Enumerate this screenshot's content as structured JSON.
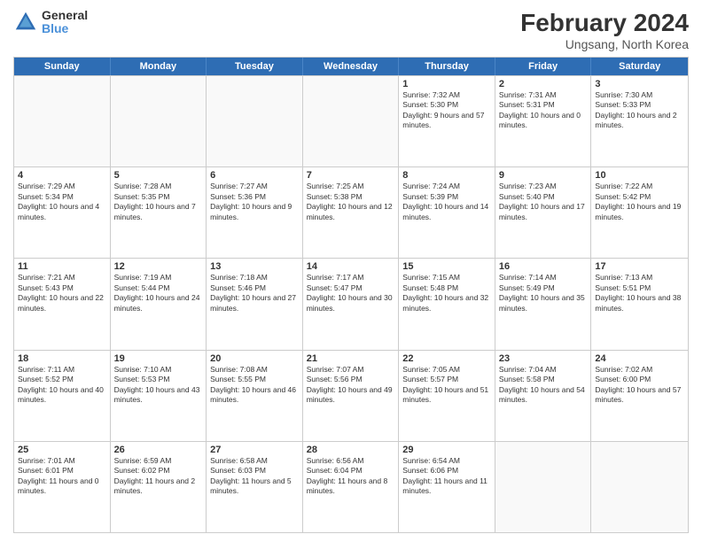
{
  "logo": {
    "general": "General",
    "blue": "Blue"
  },
  "title": {
    "month": "February 2024",
    "location": "Ungsang, North Korea"
  },
  "header_days": [
    "Sunday",
    "Monday",
    "Tuesday",
    "Wednesday",
    "Thursday",
    "Friday",
    "Saturday"
  ],
  "weeks": [
    [
      {
        "day": "",
        "content": ""
      },
      {
        "day": "",
        "content": ""
      },
      {
        "day": "",
        "content": ""
      },
      {
        "day": "",
        "content": ""
      },
      {
        "day": "1",
        "content": "Sunrise: 7:32 AM\nSunset: 5:30 PM\nDaylight: 9 hours and 57 minutes."
      },
      {
        "day": "2",
        "content": "Sunrise: 7:31 AM\nSunset: 5:31 PM\nDaylight: 10 hours and 0 minutes."
      },
      {
        "day": "3",
        "content": "Sunrise: 7:30 AM\nSunset: 5:33 PM\nDaylight: 10 hours and 2 minutes."
      }
    ],
    [
      {
        "day": "4",
        "content": "Sunrise: 7:29 AM\nSunset: 5:34 PM\nDaylight: 10 hours and 4 minutes."
      },
      {
        "day": "5",
        "content": "Sunrise: 7:28 AM\nSunset: 5:35 PM\nDaylight: 10 hours and 7 minutes."
      },
      {
        "day": "6",
        "content": "Sunrise: 7:27 AM\nSunset: 5:36 PM\nDaylight: 10 hours and 9 minutes."
      },
      {
        "day": "7",
        "content": "Sunrise: 7:25 AM\nSunset: 5:38 PM\nDaylight: 10 hours and 12 minutes."
      },
      {
        "day": "8",
        "content": "Sunrise: 7:24 AM\nSunset: 5:39 PM\nDaylight: 10 hours and 14 minutes."
      },
      {
        "day": "9",
        "content": "Sunrise: 7:23 AM\nSunset: 5:40 PM\nDaylight: 10 hours and 17 minutes."
      },
      {
        "day": "10",
        "content": "Sunrise: 7:22 AM\nSunset: 5:42 PM\nDaylight: 10 hours and 19 minutes."
      }
    ],
    [
      {
        "day": "11",
        "content": "Sunrise: 7:21 AM\nSunset: 5:43 PM\nDaylight: 10 hours and 22 minutes."
      },
      {
        "day": "12",
        "content": "Sunrise: 7:19 AM\nSunset: 5:44 PM\nDaylight: 10 hours and 24 minutes."
      },
      {
        "day": "13",
        "content": "Sunrise: 7:18 AM\nSunset: 5:46 PM\nDaylight: 10 hours and 27 minutes."
      },
      {
        "day": "14",
        "content": "Sunrise: 7:17 AM\nSunset: 5:47 PM\nDaylight: 10 hours and 30 minutes."
      },
      {
        "day": "15",
        "content": "Sunrise: 7:15 AM\nSunset: 5:48 PM\nDaylight: 10 hours and 32 minutes."
      },
      {
        "day": "16",
        "content": "Sunrise: 7:14 AM\nSunset: 5:49 PM\nDaylight: 10 hours and 35 minutes."
      },
      {
        "day": "17",
        "content": "Sunrise: 7:13 AM\nSunset: 5:51 PM\nDaylight: 10 hours and 38 minutes."
      }
    ],
    [
      {
        "day": "18",
        "content": "Sunrise: 7:11 AM\nSunset: 5:52 PM\nDaylight: 10 hours and 40 minutes."
      },
      {
        "day": "19",
        "content": "Sunrise: 7:10 AM\nSunset: 5:53 PM\nDaylight: 10 hours and 43 minutes."
      },
      {
        "day": "20",
        "content": "Sunrise: 7:08 AM\nSunset: 5:55 PM\nDaylight: 10 hours and 46 minutes."
      },
      {
        "day": "21",
        "content": "Sunrise: 7:07 AM\nSunset: 5:56 PM\nDaylight: 10 hours and 49 minutes."
      },
      {
        "day": "22",
        "content": "Sunrise: 7:05 AM\nSunset: 5:57 PM\nDaylight: 10 hours and 51 minutes."
      },
      {
        "day": "23",
        "content": "Sunrise: 7:04 AM\nSunset: 5:58 PM\nDaylight: 10 hours and 54 minutes."
      },
      {
        "day": "24",
        "content": "Sunrise: 7:02 AM\nSunset: 6:00 PM\nDaylight: 10 hours and 57 minutes."
      }
    ],
    [
      {
        "day": "25",
        "content": "Sunrise: 7:01 AM\nSunset: 6:01 PM\nDaylight: 11 hours and 0 minutes."
      },
      {
        "day": "26",
        "content": "Sunrise: 6:59 AM\nSunset: 6:02 PM\nDaylight: 11 hours and 2 minutes."
      },
      {
        "day": "27",
        "content": "Sunrise: 6:58 AM\nSunset: 6:03 PM\nDaylight: 11 hours and 5 minutes."
      },
      {
        "day": "28",
        "content": "Sunrise: 6:56 AM\nSunset: 6:04 PM\nDaylight: 11 hours and 8 minutes."
      },
      {
        "day": "29",
        "content": "Sunrise: 6:54 AM\nSunset: 6:06 PM\nDaylight: 11 hours and 11 minutes."
      },
      {
        "day": "",
        "content": ""
      },
      {
        "day": "",
        "content": ""
      }
    ]
  ]
}
